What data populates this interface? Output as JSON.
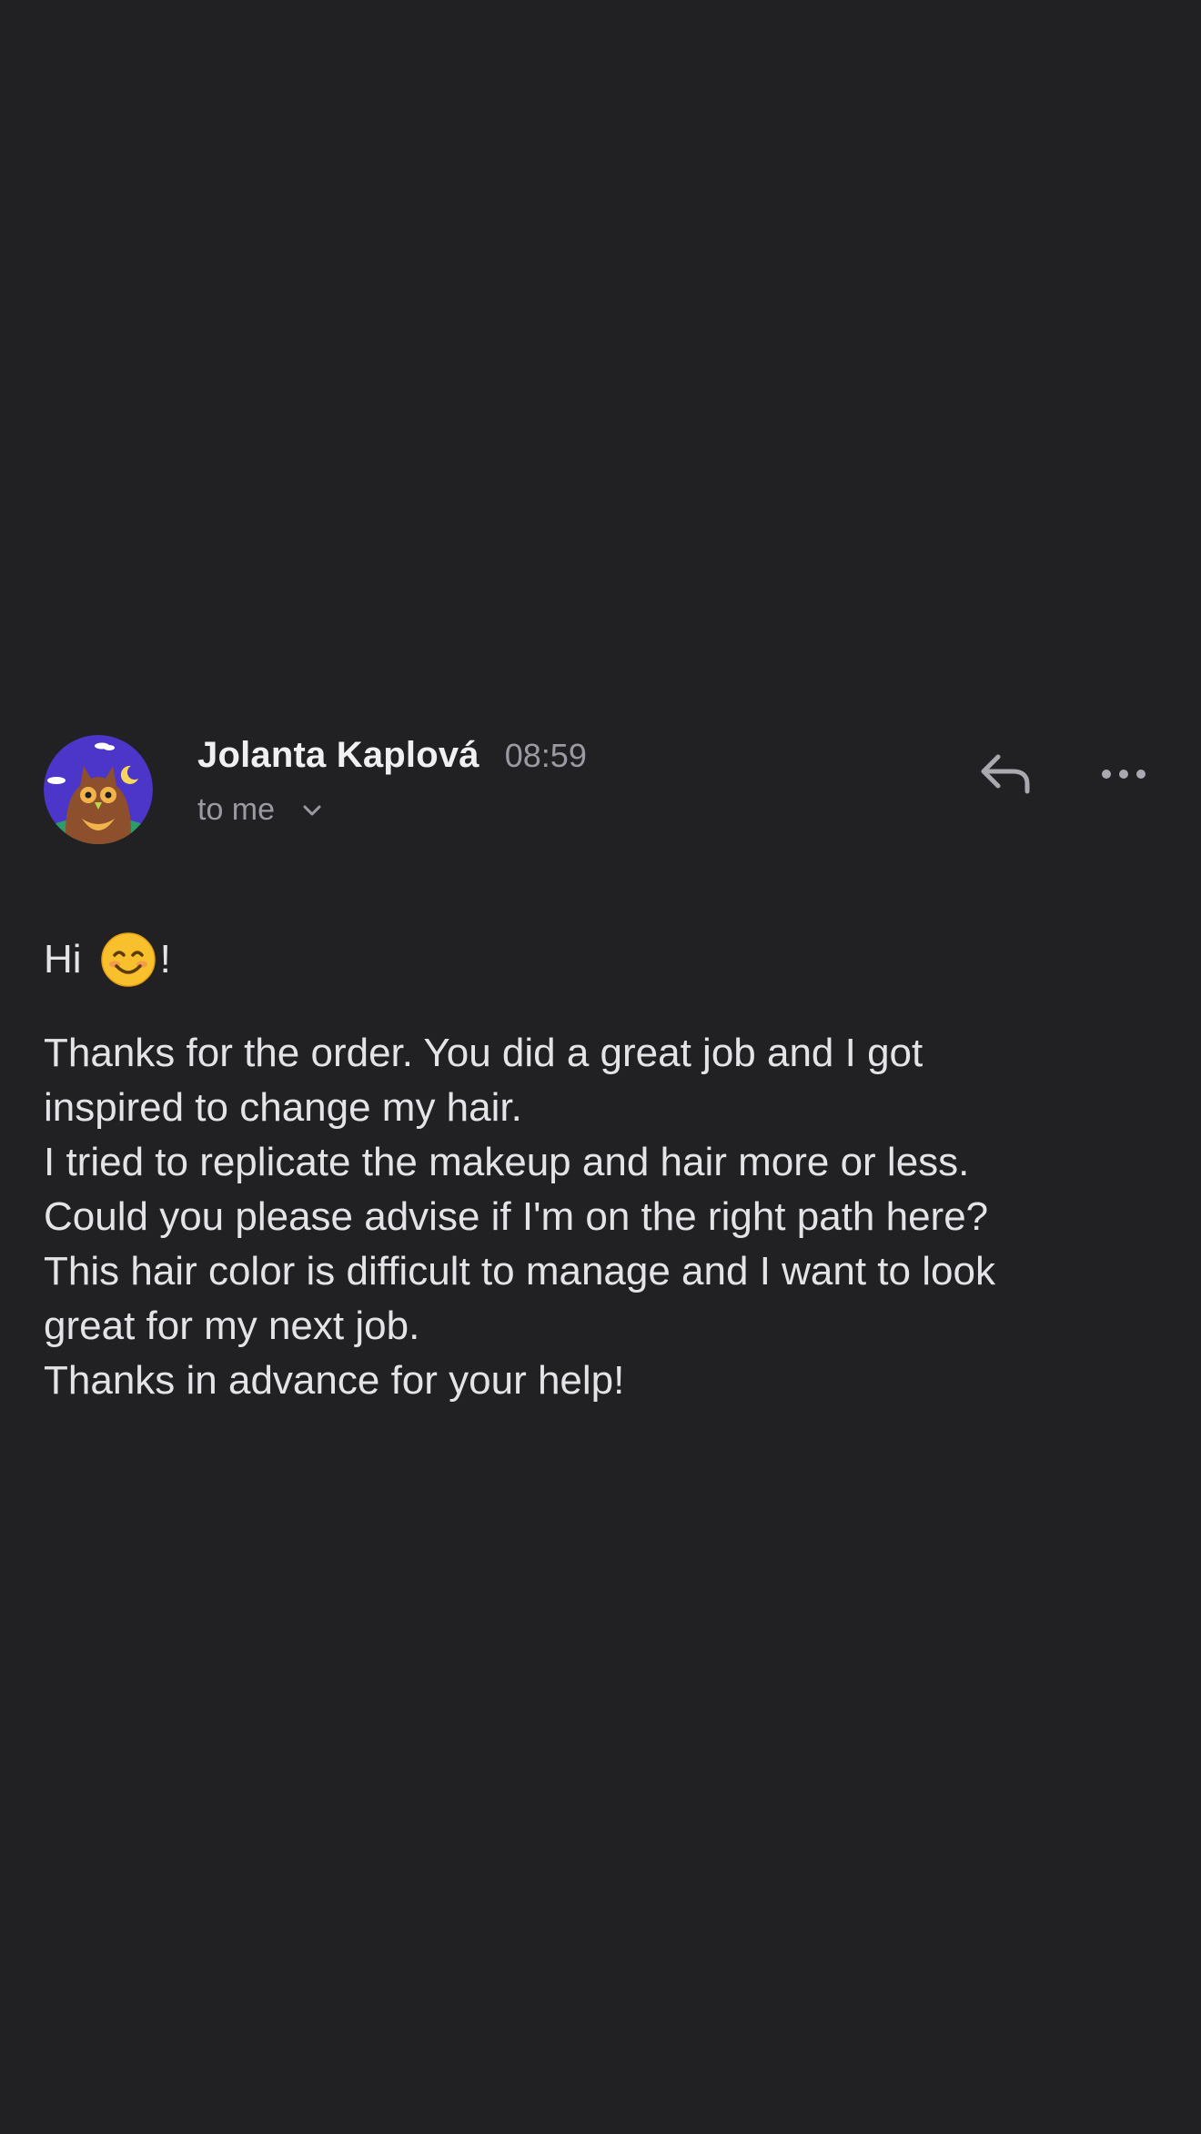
{
  "message": {
    "sender_name": "Jolanta Kaplová",
    "time": "08:59",
    "recipient_label": "to me",
    "avatar_icon": "owl-avatar-icon",
    "reply_icon": "reply-icon",
    "more_icon": "more-horizontal-icon",
    "body": {
      "greeting_start": "Hi",
      "greeting_emoji": "smiling-face-emoji",
      "greeting_end": "!",
      "lines": [
        "Thanks for the order. You did a great job and I got",
        "inspired to change my hair.",
        "I tried to replicate the makeup and hair more or less.",
        "Could you please advise if I'm on the right path here?",
        "This hair color is difficult to manage and I want to look",
        "great for my next job.",
        "Thanks in advance for your help!"
      ]
    }
  },
  "colors": {
    "background": "#212124",
    "primary_text": "#f0f0f3",
    "secondary_text": "#9a9aa2",
    "avatar_bg": "#4b36c9"
  }
}
